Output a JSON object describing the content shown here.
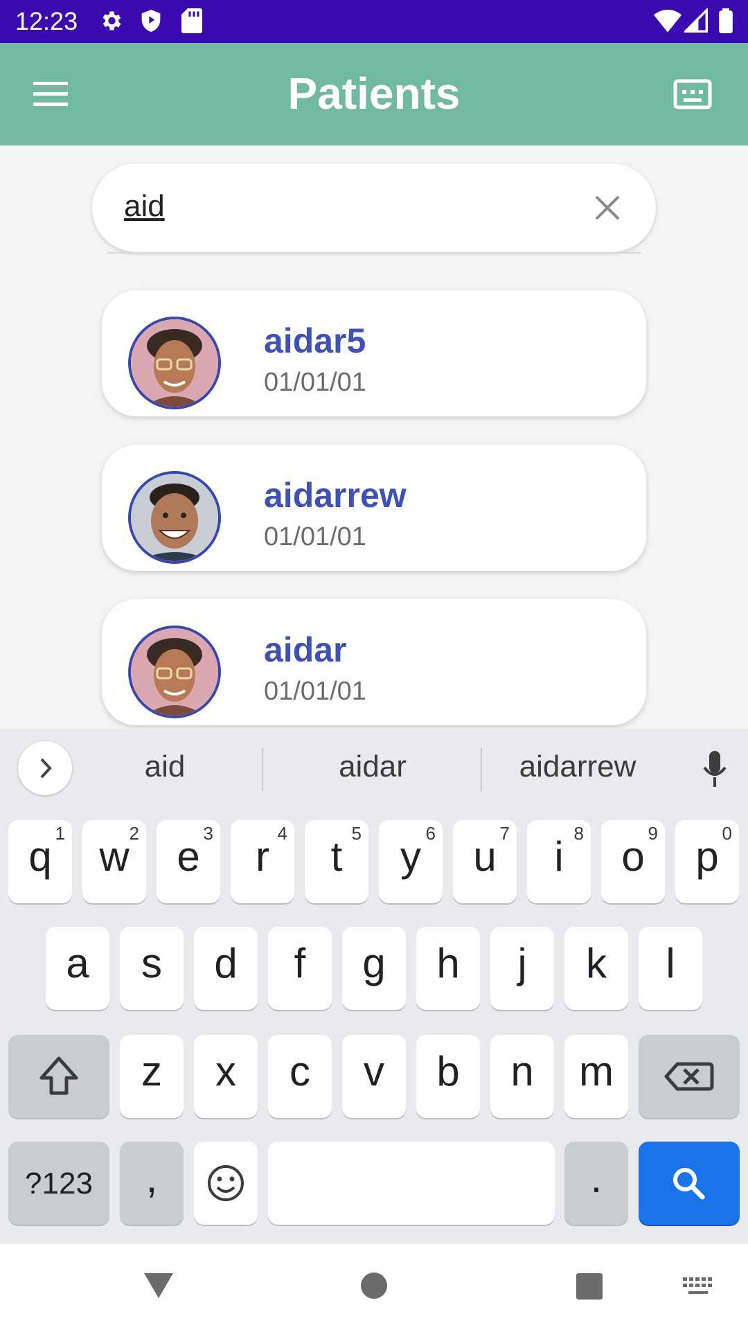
{
  "status_bar": {
    "time": "12:23"
  },
  "app_bar": {
    "title": "Patients"
  },
  "search": {
    "value": "aid"
  },
  "patients": [
    {
      "name": "aidar5",
      "date": "01/01/01"
    },
    {
      "name": "aidarrew",
      "date": "01/01/01"
    },
    {
      "name": "aidar",
      "date": "01/01/01"
    }
  ],
  "keyboard": {
    "suggestions": [
      "aid",
      "aidar",
      "aidarrew"
    ],
    "row1": [
      {
        "key": "q",
        "hint": "1"
      },
      {
        "key": "w",
        "hint": "2"
      },
      {
        "key": "e",
        "hint": "3"
      },
      {
        "key": "r",
        "hint": "4"
      },
      {
        "key": "t",
        "hint": "5"
      },
      {
        "key": "y",
        "hint": "6"
      },
      {
        "key": "u",
        "hint": "7"
      },
      {
        "key": "i",
        "hint": "8"
      },
      {
        "key": "o",
        "hint": "9"
      },
      {
        "key": "p",
        "hint": "0"
      }
    ],
    "row2": [
      "a",
      "s",
      "d",
      "f",
      "g",
      "h",
      "j",
      "k",
      "l"
    ],
    "row3": [
      "z",
      "x",
      "c",
      "v",
      "b",
      "n",
      "m"
    ],
    "symbols_label": "?123",
    "comma_label": ",",
    "period_label": "."
  },
  "colors": {
    "status_bar": "#3b0bb0",
    "app_bar": "#72ba9f",
    "patient_name": "#3f51b5",
    "search_key": "#1a73e8"
  }
}
